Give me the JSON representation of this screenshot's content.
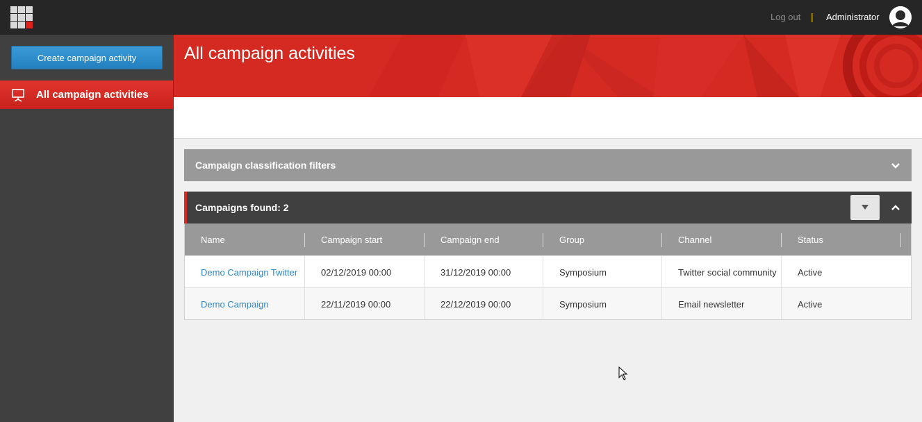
{
  "topbar": {
    "logout_label": "Log out",
    "separator": "|",
    "user_name": "Administrator",
    "app_icon": "app-grid-icon",
    "avatar_icon": "user-avatar-icon"
  },
  "sidebar": {
    "create_button_label": "Create campaign activity",
    "items": [
      {
        "label": "All campaign activities",
        "icon": "presentation-board-icon",
        "active": true
      }
    ]
  },
  "main": {
    "page_title": "All campaign activities",
    "filters_label": "Campaign classification filters",
    "results_label": "Campaigns found: 2",
    "table": {
      "columns": [
        "Name",
        "Campaign start",
        "Campaign end",
        "Group",
        "Channel",
        "Status"
      ],
      "rows": [
        [
          "Demo Campaign Twitter",
          "02/12/2019 00:00",
          "31/12/2019 00:00",
          "Symposium",
          "Twitter social community",
          "Active"
        ],
        [
          "Demo Campaign",
          "22/11/2019 00:00",
          "22/12/2019 00:00",
          "Symposium",
          "Email newsletter",
          "Active"
        ]
      ]
    }
  },
  "colors": {
    "accent_red": "#d52a24",
    "link_blue": "#2f86c4",
    "button_blue": "#2f8fd0",
    "topbar": "#262626",
    "sidebar": "#404040",
    "separator_yellow": "#f5c800"
  }
}
